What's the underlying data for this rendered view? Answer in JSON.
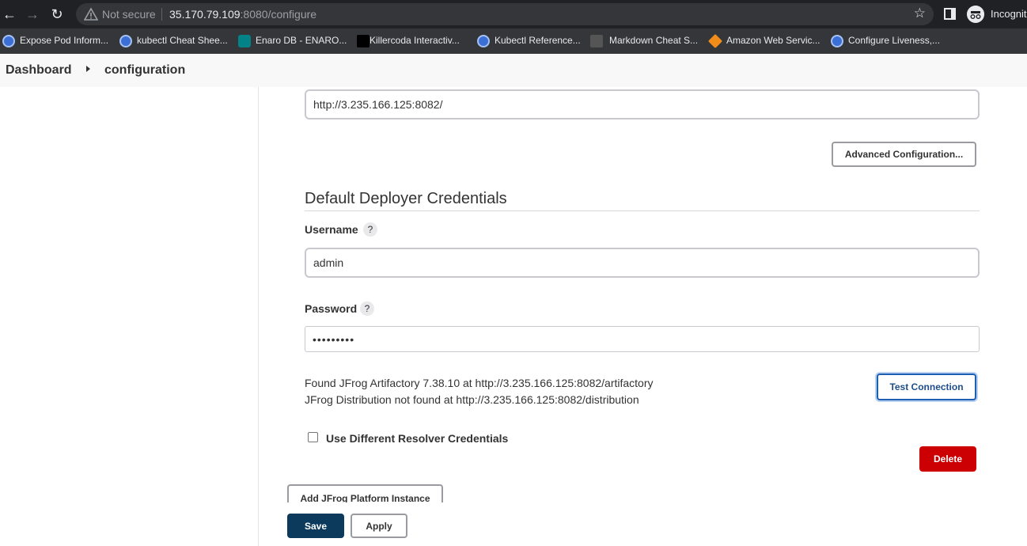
{
  "browser": {
    "not_secure_label": "Not secure",
    "url_host": "35.170.79.109",
    "url_rest": ":8080/configure",
    "incognito_label": "Incognito",
    "bookmarks": [
      {
        "label": "Expose Pod Inform...",
        "icon": "kubernetes-icon"
      },
      {
        "label": "kubectl Cheat Shee...",
        "icon": "kubernetes-icon"
      },
      {
        "label": "Enaro DB - ENARO...",
        "icon": "sharepoint-icon"
      },
      {
        "label": "Killercoda Interactiv...",
        "icon": "killercoda-icon"
      },
      {
        "label": "Kubectl Reference...",
        "icon": "kubernetes-icon"
      },
      {
        "label": "Markdown Cheat S...",
        "icon": "markdown-icon"
      },
      {
        "label": "Amazon Web Servic...",
        "icon": "aws-icon"
      },
      {
        "label": "Configure Liveness,...",
        "icon": "kubernetes-icon"
      }
    ]
  },
  "breadcrumb": {
    "dashboard": "Dashboard",
    "configuration": "configuration"
  },
  "form": {
    "server_url_value": "http://3.235.166.125:8082/",
    "advanced_button": "Advanced Configuration...",
    "section_title": "Default Deployer Credentials",
    "username_label": "Username",
    "username_value": "admin",
    "password_label": "Password",
    "password_value": "•••••••••",
    "help_glyph": "?",
    "status_found": "Found JFrog Artifactory 7.38.10 at http://3.235.166.125:8082/artifactory",
    "status_not_found": "JFrog Distribution not found at http://3.235.166.125:8082/distribution",
    "test_button": "Test Connection",
    "resolver_checkbox_label": "Use Different Resolver Credentials",
    "resolver_checked": false,
    "delete_button": "Delete",
    "add_instance_button": "Add JFrog Platform Instance",
    "save_button": "Save",
    "apply_button": "Apply"
  },
  "colors": {
    "delete": "#cc0003",
    "save": "#0b3a5c",
    "test_border": "#1e5fb4"
  }
}
